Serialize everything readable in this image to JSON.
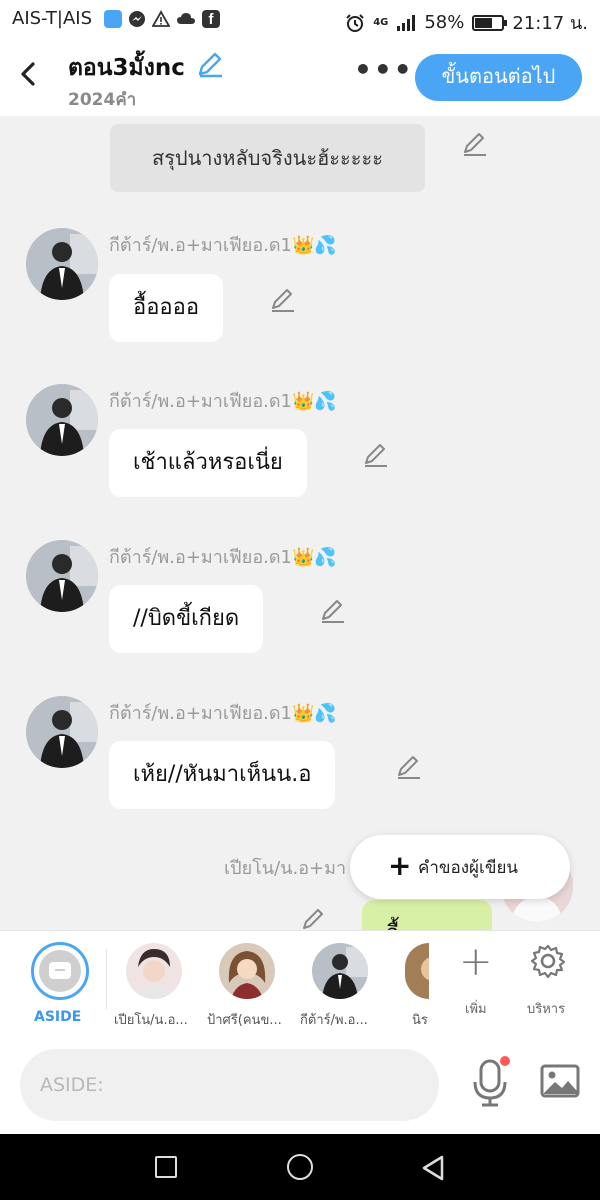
{
  "status_bar": {
    "carrier": "AIS-T|AIS",
    "network": "4G",
    "battery": "58%",
    "battery_level": 0.58,
    "time": "21:17 น."
  },
  "header": {
    "title": "ตอน3มั้งnc",
    "word_count": "2024คำ",
    "more_label": "•••",
    "next_button": "ขั้นตอนต่อไป"
  },
  "chat": {
    "narration": "สรุปนางหลับจริงนะฮ้ะะะะะ",
    "messages": [
      {
        "speaker": "กีต้าร์/พ.อ+มาเฟียอ.ด1👑💦",
        "text": "อื้ออออ"
      },
      {
        "speaker": "กีต้าร์/พ.อ+มาเฟียอ.ด1👑💦",
        "text": "เช้าแล้วหรอเนี่ย"
      },
      {
        "speaker": "กีต้าร์/พ.อ+มาเฟียอ.ด1👑💦",
        "text": "//บิดขี้เกียด"
      },
      {
        "speaker": "กีต้าร์/พ.อ+มาเฟียอ.ด1👑💦",
        "text": "เห้ย//หันมาเห็นน.อ"
      }
    ],
    "partial_speaker": "เปียโน/น.อ+มา",
    "partial_bubble": "อื้"
  },
  "author_note_button": "คำของผู้เขียน",
  "character_bar": {
    "aside_label": "ASIDE",
    "characters": [
      {
        "label": "เปียโน/น.อ..."
      },
      {
        "label": "ป้าศรี(คนข..."
      },
      {
        "label": "กีต้าร์/พ.อ..."
      },
      {
        "label": "นิร"
      }
    ],
    "add_label": "เพิ่ม",
    "manage_label": "บริหาร"
  },
  "input": {
    "placeholder": "ASIDE:"
  },
  "colors": {
    "accent": "#4aa6f5",
    "bubble": "#ffffff",
    "narration_bg": "#e3e3e3",
    "own_bubble": "#d8f0a6",
    "background": "#f1f1f1"
  }
}
